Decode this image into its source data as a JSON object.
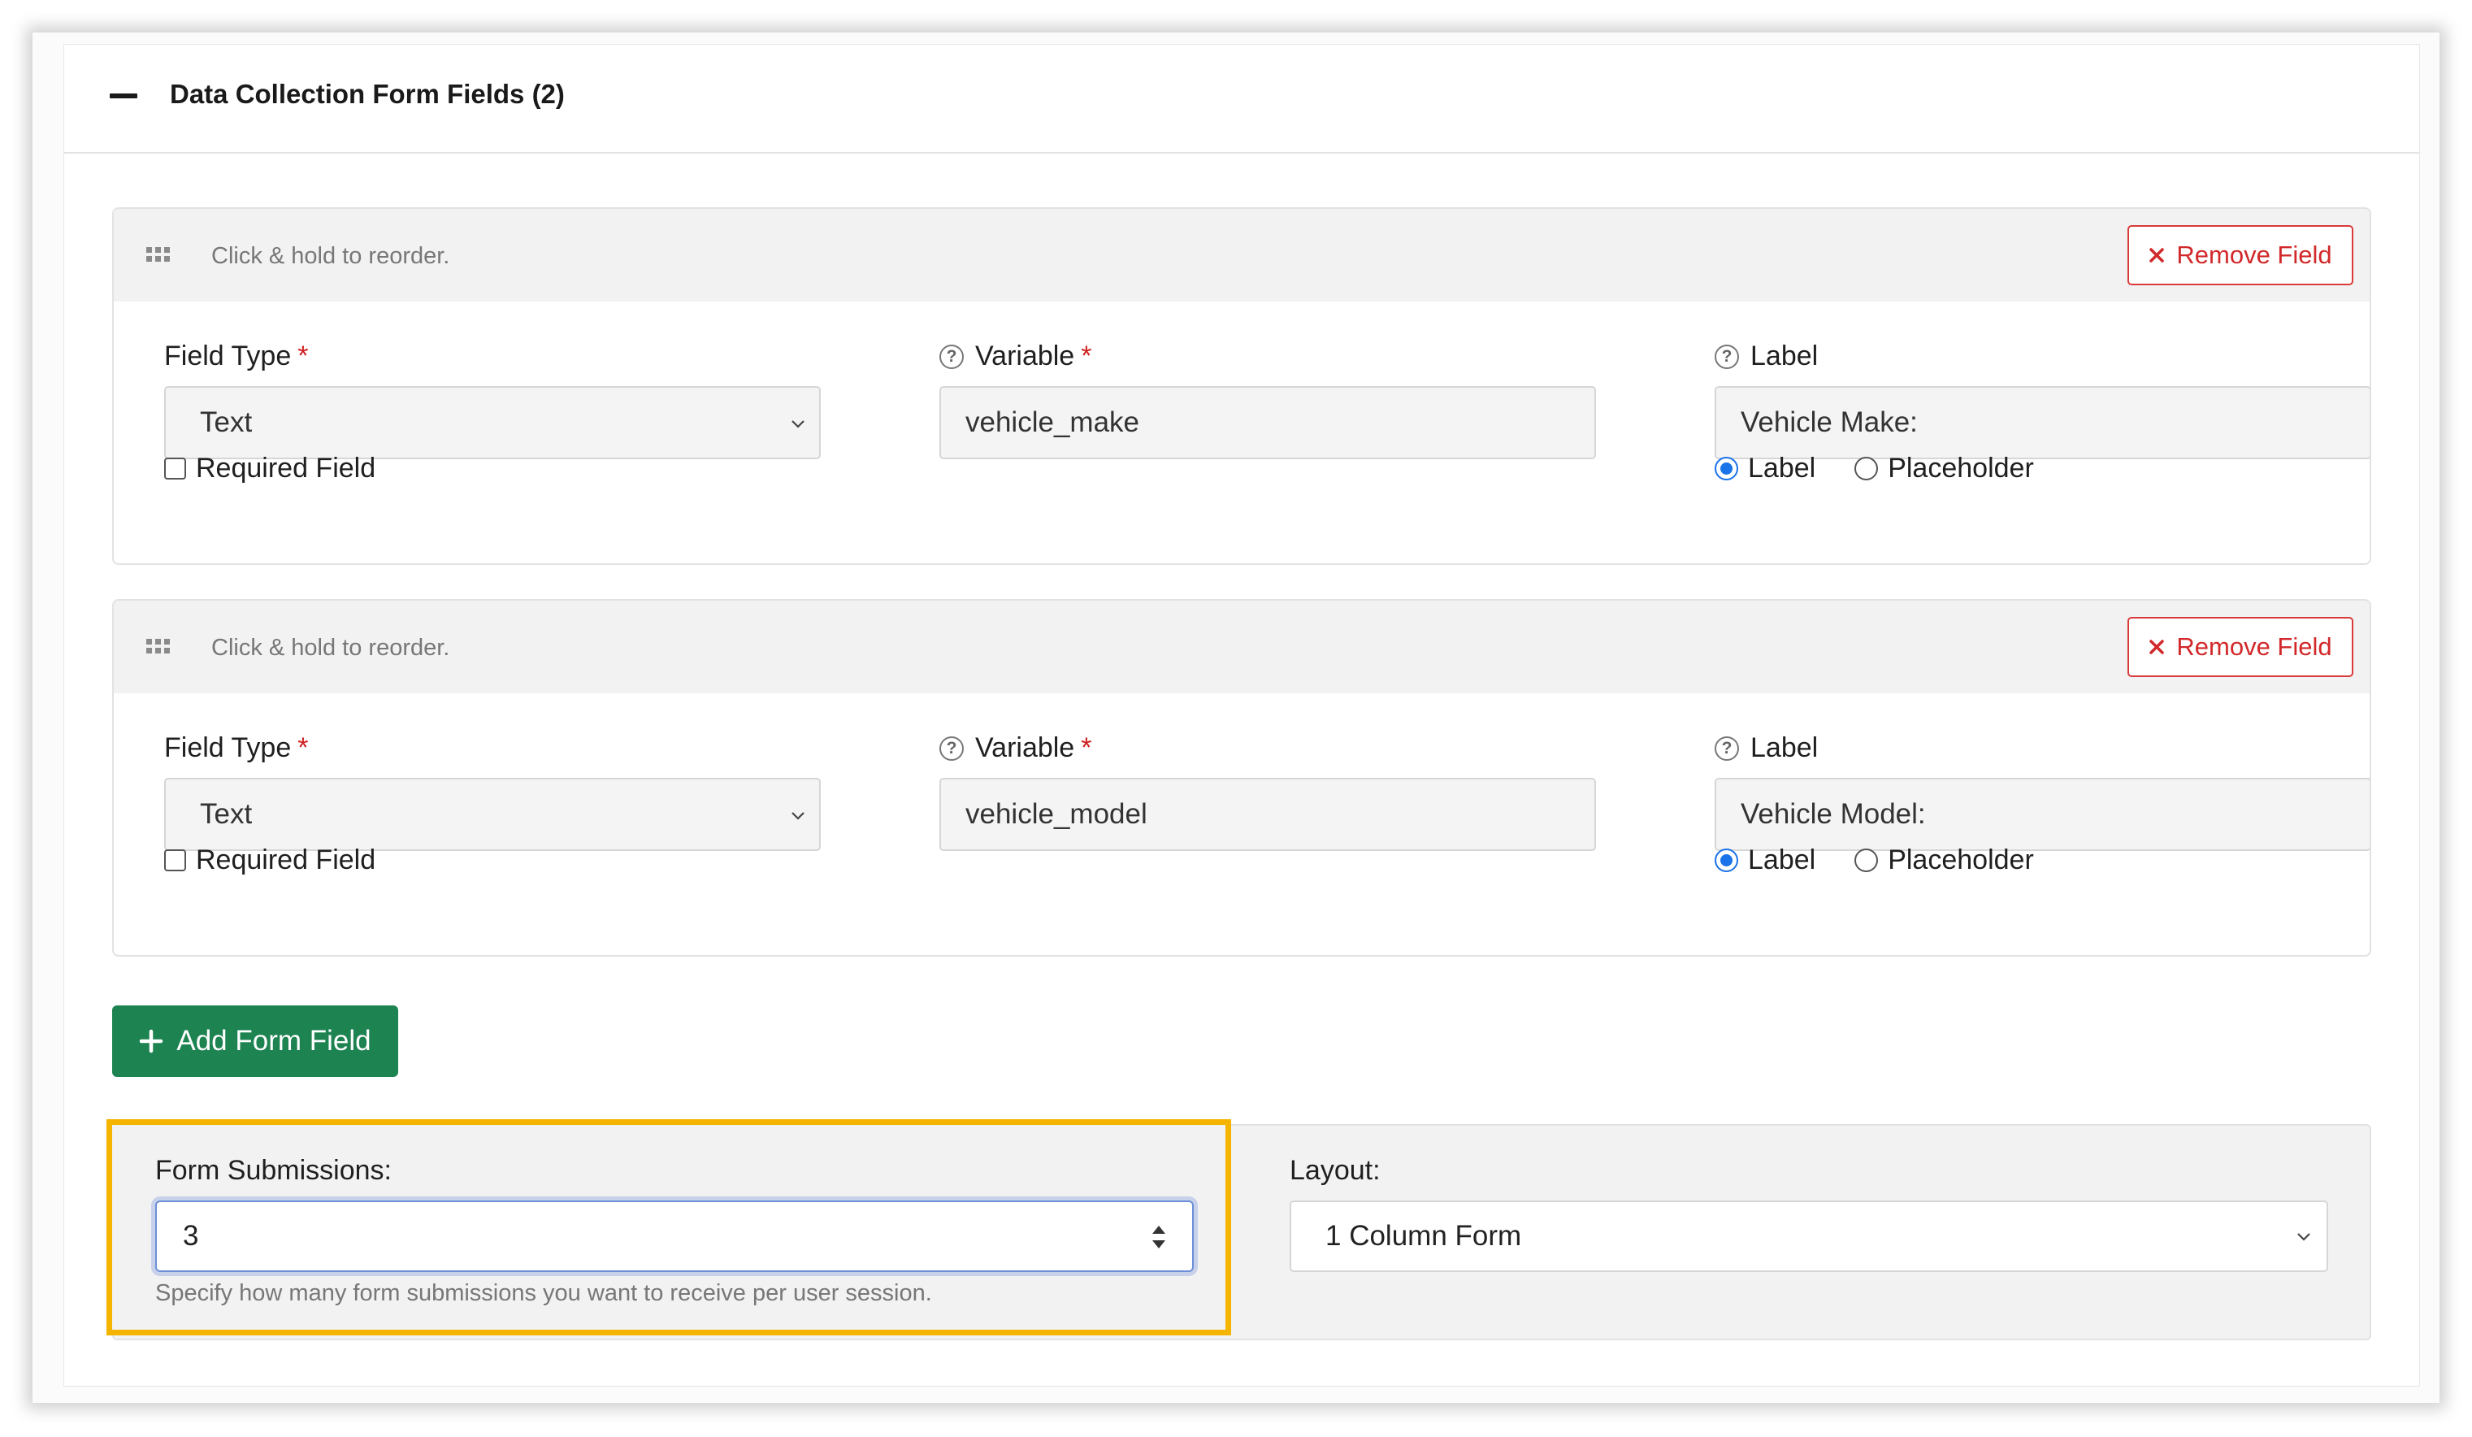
{
  "panel": {
    "title": "Data Collection Form Fields (2)"
  },
  "fields": [
    {
      "reorder_hint": "Click & hold to reorder.",
      "remove_label": "Remove Field",
      "field_type_label": "Field Type",
      "field_type_value": "Text",
      "variable_label": "Variable",
      "variable_value": "vehicle_make",
      "label_label": "Label",
      "label_value": "Vehicle Make:",
      "required_label": "Required Field",
      "required_checked": false,
      "display_options": [
        "Label",
        "Placeholder"
      ],
      "display_selected": "Label"
    },
    {
      "reorder_hint": "Click & hold to reorder.",
      "remove_label": "Remove Field",
      "field_type_label": "Field Type",
      "field_type_value": "Text",
      "variable_label": "Variable",
      "variable_value": "vehicle_model",
      "label_label": "Label",
      "label_value": "Vehicle Model:",
      "required_label": "Required Field",
      "required_checked": false,
      "display_options": [
        "Label",
        "Placeholder"
      ],
      "display_selected": "Label"
    }
  ],
  "add_button": {
    "label": "Add Form Field"
  },
  "settings": {
    "submissions_label": "Form Submissions:",
    "submissions_value": "3",
    "submissions_hint": "Specify how many form submissions you want to receive per user session.",
    "layout_label": "Layout:",
    "layout_value": "1 Column Form"
  },
  "colors": {
    "remove": "#d2282a",
    "add_button": "#1d8350",
    "highlight": "#f4b400",
    "radio_selected": "#1a73e8"
  },
  "icons": {
    "collapse": "minus-icon",
    "drag": "grip-icon",
    "remove": "close-icon",
    "help": "question-circle-icon",
    "add": "plus-icon",
    "select": "chevron-down-icon",
    "spinner": "spinner-arrows-icon"
  }
}
